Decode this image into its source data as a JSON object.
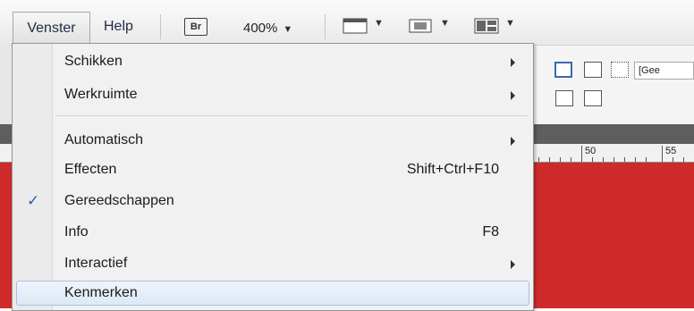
{
  "menubar": {
    "venster": "Venster",
    "help": "Help",
    "br": "Br",
    "zoom": "400%"
  },
  "panel": {
    "field_value": "[Gee"
  },
  "ruler": {
    "label_50": "50",
    "label_55": "55"
  },
  "menu": {
    "items": [
      {
        "label": "Schikken",
        "shortcut": "",
        "submenu": true,
        "checked": false
      },
      {
        "label": "Werkruimte",
        "shortcut": "",
        "submenu": true,
        "checked": false
      },
      {
        "label": "Automatisch",
        "shortcut": "",
        "submenu": true,
        "checked": false
      },
      {
        "label": "Effecten",
        "shortcut": "Shift+Ctrl+F10",
        "submenu": false,
        "checked": false
      },
      {
        "label": "Gereedschappen",
        "shortcut": "",
        "submenu": false,
        "checked": true
      },
      {
        "label": "Info",
        "shortcut": "F8",
        "submenu": false,
        "checked": false
      },
      {
        "label": "Interactief",
        "shortcut": "",
        "submenu": true,
        "checked": false
      },
      {
        "label": "Kenmerken",
        "shortcut": "",
        "submenu": false,
        "checked": false
      }
    ],
    "check_glyph": "✓"
  },
  "colors": {
    "document": "#cf2a2a",
    "accent": "#2d5faa"
  }
}
